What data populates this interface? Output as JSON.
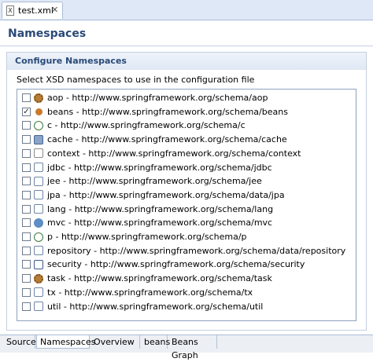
{
  "editor": {
    "file_tab_label": "test.xml",
    "file_icon_glyph": "X",
    "close_glyph": "✕"
  },
  "page": {
    "title": "Namespaces",
    "section_title": "Configure Namespaces",
    "description": "Select XSD namespaces to use in the configuration file"
  },
  "namespaces": [
    {
      "label": "aop - http://www.springframework.org/schema/aop",
      "checked": false,
      "icon": "aop-icon"
    },
    {
      "label": "beans - http://www.springframework.org/schema/beans",
      "checked": true,
      "icon": "bean-icon"
    },
    {
      "label": "c - http://www.springframework.org/schema/c",
      "checked": false,
      "icon": "c-icon"
    },
    {
      "label": "cache - http://www.springframework.org/schema/cache",
      "checked": false,
      "icon": "cache-icon"
    },
    {
      "label": "context - http://www.springframework.org/schema/context",
      "checked": false,
      "icon": "context-icon"
    },
    {
      "label": "jdbc - http://www.springframework.org/schema/jdbc",
      "checked": false,
      "icon": "jdbc-icon"
    },
    {
      "label": "jee - http://www.springframework.org/schema/jee",
      "checked": false,
      "icon": "jee-icon"
    },
    {
      "label": "jpa - http://www.springframework.org/schema/data/jpa",
      "checked": false,
      "icon": "jpa-icon"
    },
    {
      "label": "lang - http://www.springframework.org/schema/lang",
      "checked": false,
      "icon": "lang-icon"
    },
    {
      "label": "mvc - http://www.springframework.org/schema/mvc",
      "checked": false,
      "icon": "mvc-icon"
    },
    {
      "label": "p - http://www.springframework.org/schema/p",
      "checked": false,
      "icon": "p-icon"
    },
    {
      "label": "repository - http://www.springframework.org/schema/data/repository",
      "checked": false,
      "icon": "repository-icon"
    },
    {
      "label": "security - http://www.springframework.org/schema/security",
      "checked": false,
      "icon": "security-icon"
    },
    {
      "label": "task - http://www.springframework.org/schema/task",
      "checked": false,
      "icon": "task-icon"
    },
    {
      "label": "tx - http://www.springframework.org/schema/tx",
      "checked": false,
      "icon": "tx-icon"
    },
    {
      "label": "util - http://www.springframework.org/schema/util",
      "checked": false,
      "icon": "util-icon"
    }
  ],
  "bottom_tabs": [
    {
      "label": "Source",
      "active": false
    },
    {
      "label": "Namespaces",
      "active": true
    },
    {
      "label": "Overview",
      "active": false
    },
    {
      "label": "beans",
      "active": false
    },
    {
      "label": "Beans Graph",
      "active": false
    }
  ],
  "colors": {
    "title": "#2a4a78",
    "tab_bar": "#dfe8f6",
    "border": "#a9bcd6"
  }
}
